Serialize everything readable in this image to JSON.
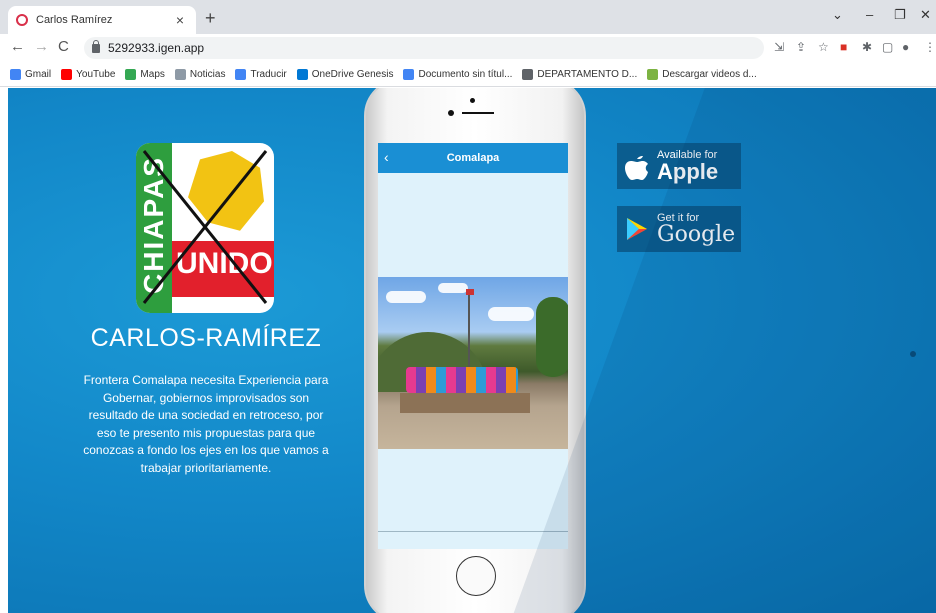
{
  "browser": {
    "tab_title": "Carlos Ramírez",
    "tab_close": "×",
    "new_tab": "+",
    "window_controls": {
      "dropdown": "⌄",
      "minimize": "–",
      "restore": "❐",
      "close": "✕"
    },
    "nav": {
      "back": "←",
      "forward": "→",
      "reload": "C"
    },
    "url": "5292933.igen.app",
    "bookmarks": [
      {
        "label": "Gmail",
        "icon": "gmail-icon",
        "color": "#4285f4"
      },
      {
        "label": "YouTube",
        "icon": "youtube-icon",
        "color": "#ff0000"
      },
      {
        "label": "Maps",
        "icon": "maps-icon",
        "color": "#34a853"
      },
      {
        "label": "Noticias",
        "icon": "news-icon",
        "color": "#8e9aa6"
      },
      {
        "label": "Traducir",
        "icon": "translate-icon",
        "color": "#4285f4"
      },
      {
        "label": "OneDrive Genesis",
        "icon": "onedrive-icon",
        "color": "#0078d4"
      },
      {
        "label": "Documento sin títul...",
        "icon": "docs-icon",
        "color": "#4285f4"
      },
      {
        "label": "DEPARTAMENTO D...",
        "icon": "globe-icon",
        "color": "#5f6368"
      },
      {
        "label": "Descargar videos d...",
        "icon": "download-icon",
        "color": "#7cb342"
      }
    ]
  },
  "page": {
    "logo": {
      "vertical_text": "CHIAPAS",
      "badge_text": "UNIDO"
    },
    "name": "CARLOS-RAMÍREZ",
    "description": "Frontera Comalapa necesita Experiencia para Gobernar, gobiernos improvisados son resultado de una sociedad en retroceso, por eso te presento mis propuestas para que conozcas a fondo los ejes en los que vamos a trabajar prioritariamente.",
    "phone": {
      "header_title": "Comalapa",
      "back_icon": "‹"
    },
    "stores": {
      "apple": {
        "small": "Available for",
        "big": "Apple"
      },
      "google": {
        "small": "Get it for",
        "big": "Google"
      }
    },
    "colors": {
      "background": "#1287c8",
      "badge": "#0b5d8f",
      "app_header": "#1a8fd4"
    }
  }
}
